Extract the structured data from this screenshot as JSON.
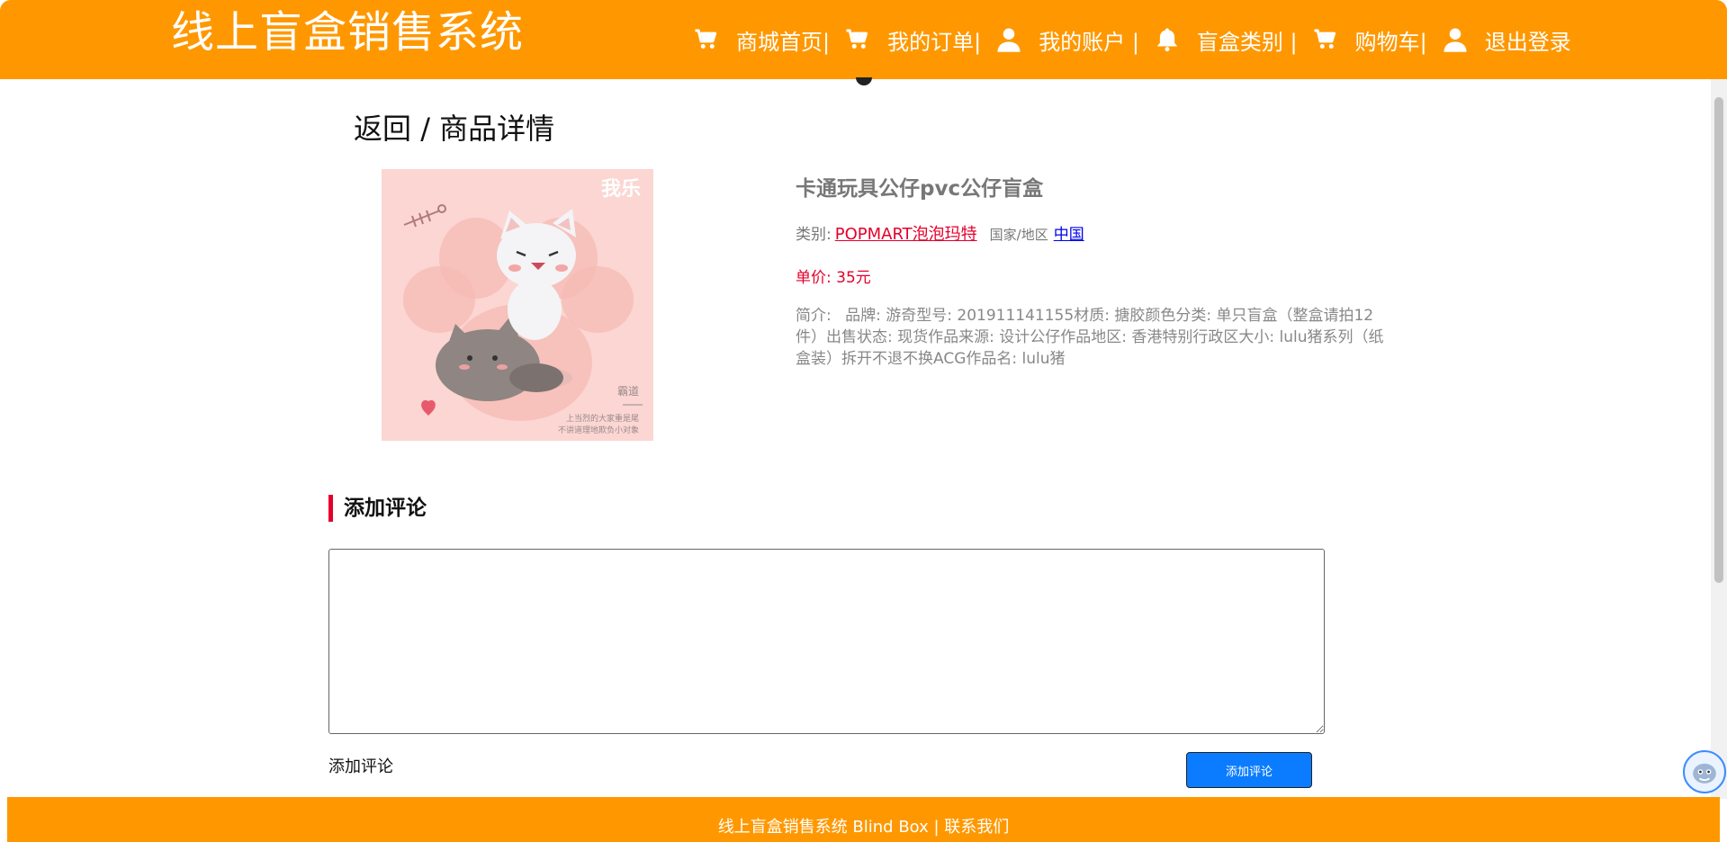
{
  "header": {
    "brand": "线上盲盒销售系统",
    "nav": [
      {
        "label": "商城首页|",
        "icon": "cart-icon"
      },
      {
        "label": "我的订单|",
        "icon": "cart-icon"
      },
      {
        "label": "我的账户 |",
        "icon": "user-icon"
      },
      {
        "label": "盲盒类别 |",
        "icon": "bell-icon"
      },
      {
        "label": "购物车|",
        "icon": "cart-icon"
      },
      {
        "label": "退出登录",
        "icon": "user-icon"
      }
    ]
  },
  "breadcrumb": {
    "back": "返回",
    "sep": " / ",
    "current": "商品详情"
  },
  "product": {
    "title": "卡通玩具公仔pvc公仔盲盒",
    "category_label": "类别:",
    "category": "POPMART泡泡玛特",
    "region_label": "国家/地区",
    "region": "中国",
    "price_label": "单价:",
    "price": "35元",
    "desc_label": "简介:",
    "desc": "品牌: 游奇型号: 201911141155材质: 搪胶颜色分类: 单只盲盒（整盒请拍12件）出售状态: 现货作品来源: 设计公仔作品地区: 香港特别行政区大小: lulu猪系列（纸盒装）拆开不退不换ACG作品名: lulu猪",
    "image_text": {
      "logo": "我乐",
      "name": "霸道",
      "line1": "上当烈的大家重是尾",
      "line2": "不讲道理地欺负小对象"
    }
  },
  "comment": {
    "section_title": "添加评论",
    "label": "添加评论",
    "button": "添加评论",
    "placeholder": ""
  },
  "footer": {
    "text": "线上盲盒销售系统 Blind Box | ",
    "link": "联系我们"
  },
  "colors": {
    "brand": "#ff9800",
    "accent": "#e4002b",
    "button": "#0b7cff"
  }
}
